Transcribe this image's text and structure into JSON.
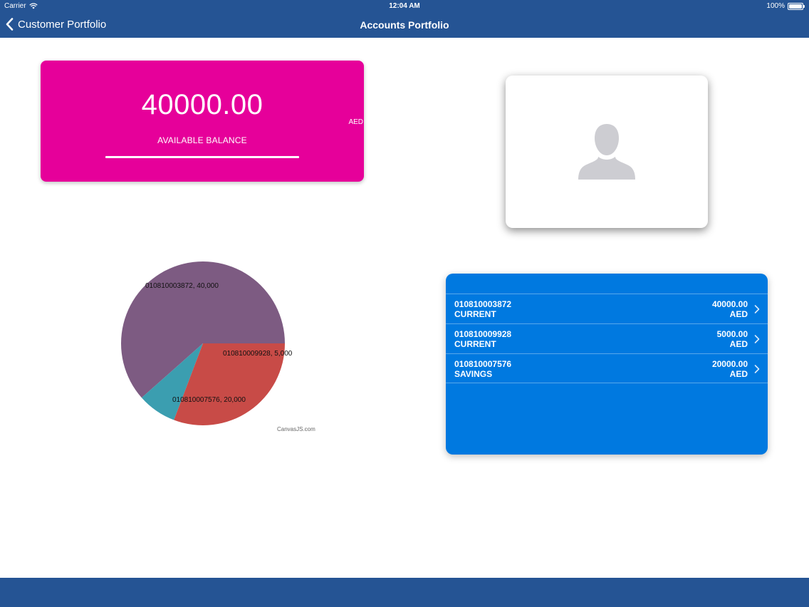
{
  "status_bar": {
    "carrier": "Carrier",
    "time": "12:04 AM",
    "battery": "100%"
  },
  "nav": {
    "back_label": "Customer Portfolio",
    "title": "Accounts Portfolio"
  },
  "balance": {
    "amount": "40000.00",
    "currency": "AED",
    "label": "AVAILABLE BALANCE"
  },
  "accounts": [
    {
      "number": "010810003872",
      "type": "CURRENT",
      "balance": "40000.00",
      "currency": "AED"
    },
    {
      "number": "010810009928",
      "type": "CURRENT",
      "balance": "5000.00",
      "currency": "AED"
    },
    {
      "number": "010810007576",
      "type": "SAVINGS",
      "balance": "20000.00",
      "currency": "AED"
    }
  ],
  "chart_data": {
    "type": "pie",
    "slices": [
      {
        "label": "010810003872, 40,000",
        "name": "010810003872",
        "value": 40000,
        "color": "#7d5b82"
      },
      {
        "label": "010810009928, 5,000",
        "name": "010810009928",
        "value": 5000,
        "color": "#3b9eb0"
      },
      {
        "label": "010810007576, 20,000",
        "name": "010810007576",
        "value": 20000,
        "color": "#c84b47"
      }
    ],
    "credit": "CanvasJS.com"
  },
  "colors": {
    "header": "#255494",
    "balance_card": "#e6009a",
    "accounts_card": "#0079e0"
  }
}
